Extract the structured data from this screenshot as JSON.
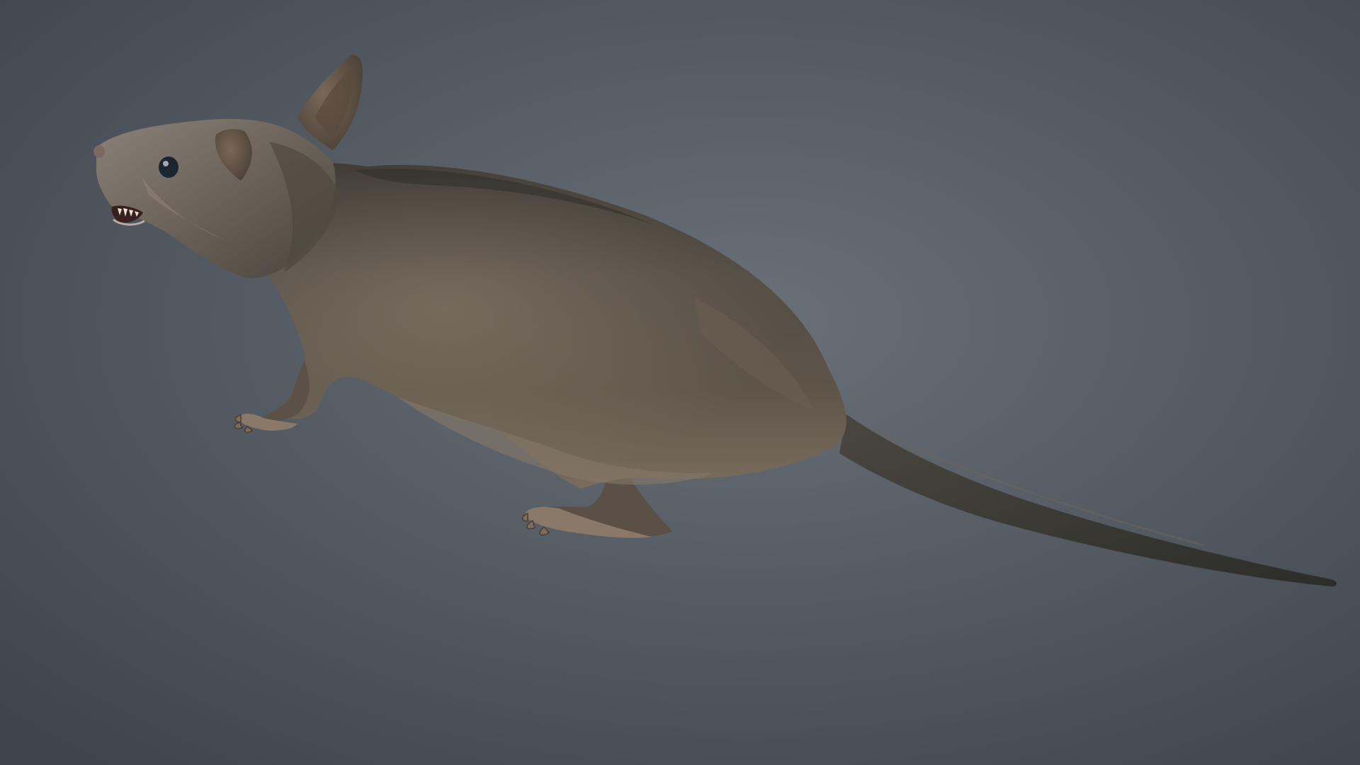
{
  "scene": {
    "subject": "rat",
    "colors": {
      "background_center": "#697078",
      "background_edge": "#3f454c",
      "fur_main": "#4d4842",
      "fur_light": "#7a6d5e",
      "fur_shadow": "#2b2824",
      "belly": "#857868",
      "tail": "#3a3b35",
      "skin": "#8e7f72",
      "eye": "#1c2630",
      "teeth": "#e6e2d8",
      "mouth": "#3a1f1f"
    }
  }
}
